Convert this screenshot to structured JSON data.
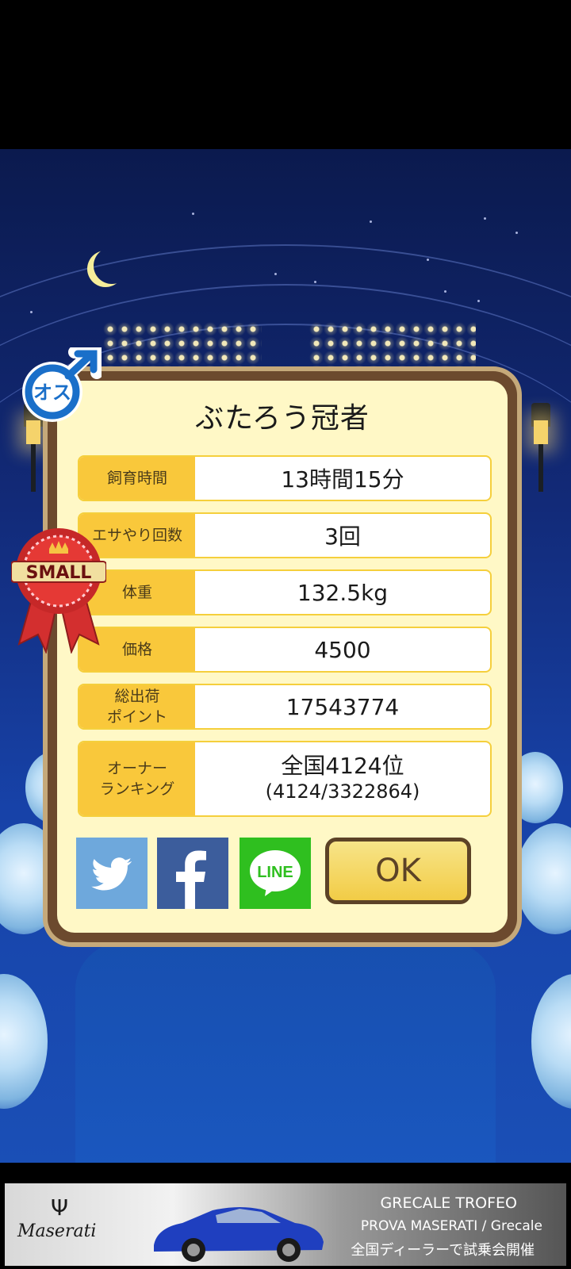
{
  "dialog": {
    "title": "ぶたろう冠者",
    "rows": [
      {
        "label": "飼育時間",
        "value": "13時間15分"
      },
      {
        "label": "エサやり回数",
        "value": "3回"
      },
      {
        "label": "体重",
        "value": "132.5kg"
      },
      {
        "label": "価格",
        "value": "4500"
      },
      {
        "label": "総出荷\nポイント",
        "value": "17543774"
      },
      {
        "label": "オーナー\nランキング",
        "value": "全国4124位",
        "value_sub": "(4124/3322864)"
      }
    ],
    "ok_label": "OK",
    "line_label": "LINE"
  },
  "badges": {
    "gender_label": "オス",
    "size_label": "SMALL"
  },
  "ad": {
    "brand": "Maserati",
    "line1": "GRECALE TROFEO",
    "line2": "PROVA MASERATI / Grecale",
    "line3": "全国ディーラーで試乗会開催"
  },
  "colors": {
    "label_bg": "#f9c83b",
    "panel_bg": "#fff8c6",
    "frame": "#6c4a2e",
    "ok_bg": "#f2cc46",
    "twitter": "#6ea8dc",
    "facebook": "#3c5d9c",
    "line": "#2fbf1f"
  },
  "icons": [
    "male-symbol-icon",
    "ribbon-icon",
    "crown-icon",
    "twitter-bird-icon",
    "facebook-f-icon",
    "line-icon",
    "moon-icon",
    "street-lamp-icon"
  ]
}
